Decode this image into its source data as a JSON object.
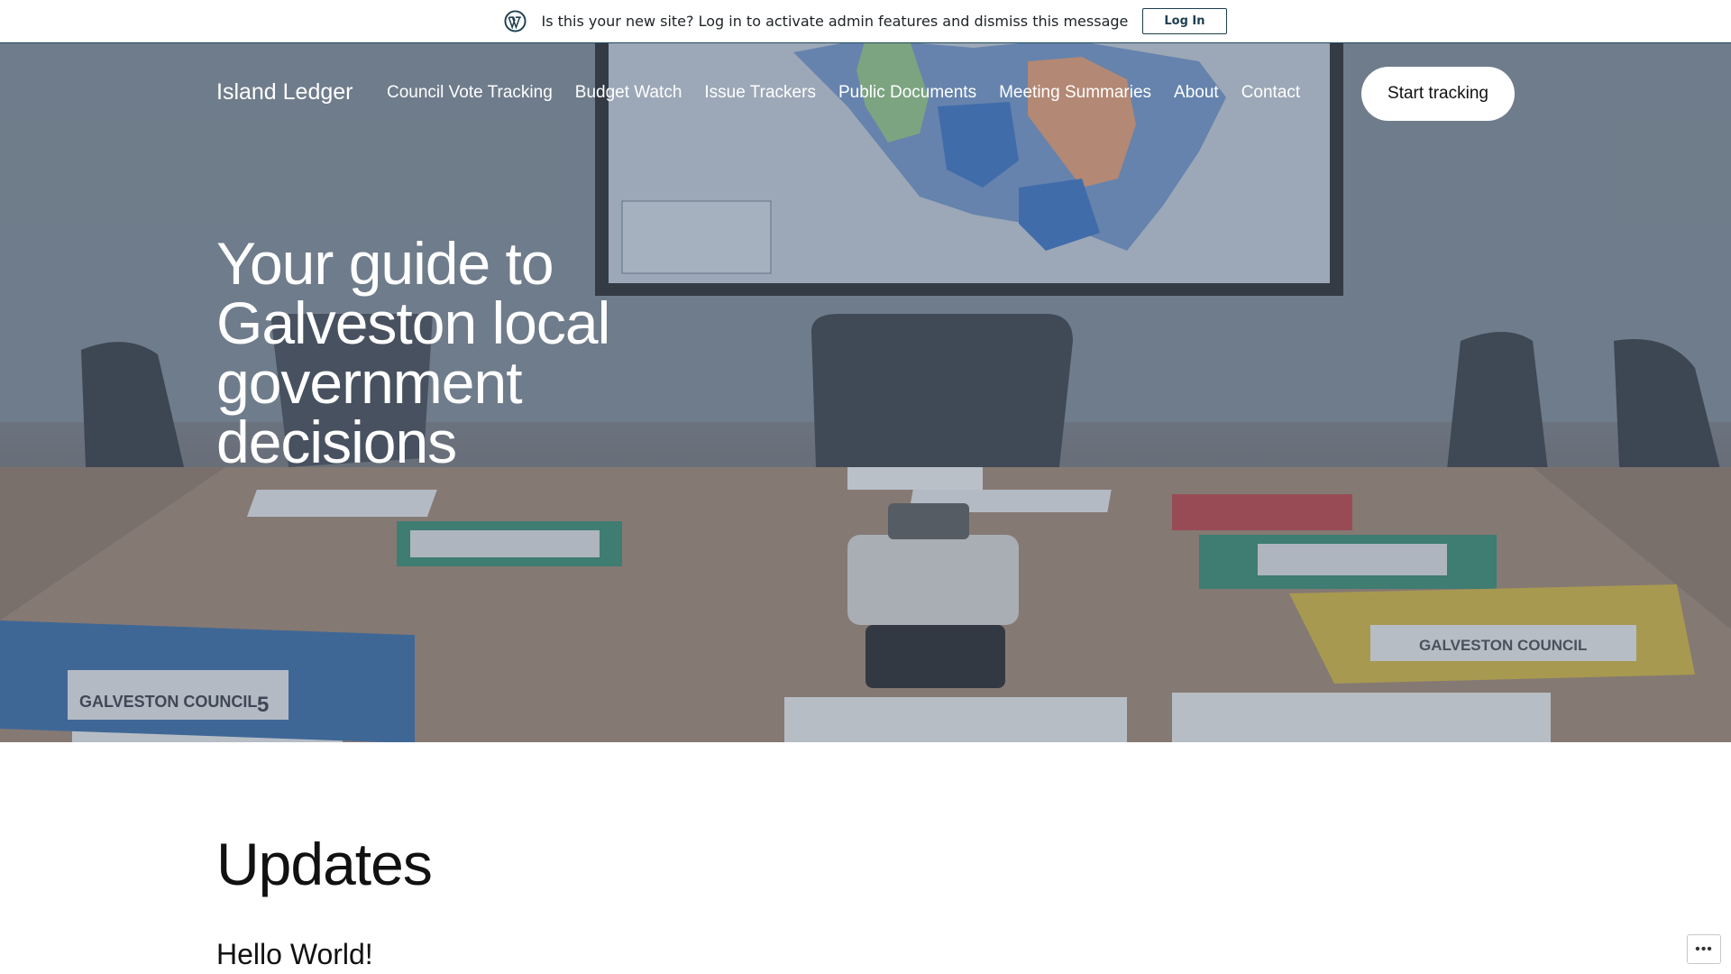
{
  "admin_notice": {
    "icon": "wordpress-logo-icon",
    "message": "Is this your new site? Log in to activate admin features and dismiss this message",
    "login_label": "Log In"
  },
  "header": {
    "site_title": "Island Ledger",
    "nav": [
      {
        "label": "Council Vote Tracking"
      },
      {
        "label": "Budget Watch"
      },
      {
        "label": "Issue Trackers"
      },
      {
        "label": "Public Documents"
      },
      {
        "label": "Meeting Summaries"
      },
      {
        "label": "About"
      },
      {
        "label": "Contact"
      }
    ],
    "cta_label": "Start tracking"
  },
  "hero": {
    "heading": "Your guide to Galveston local government decisions",
    "image_binders": [
      "GALVESTON COUNCIL",
      "5",
      "GALVESTON COUNCIL"
    ]
  },
  "main": {
    "section_heading": "Updates",
    "posts": [
      {
        "title": "Hello World!"
      }
    ]
  },
  "floating": {
    "more_options_icon": "ellipsis-icon",
    "more_options_label": "•••"
  }
}
